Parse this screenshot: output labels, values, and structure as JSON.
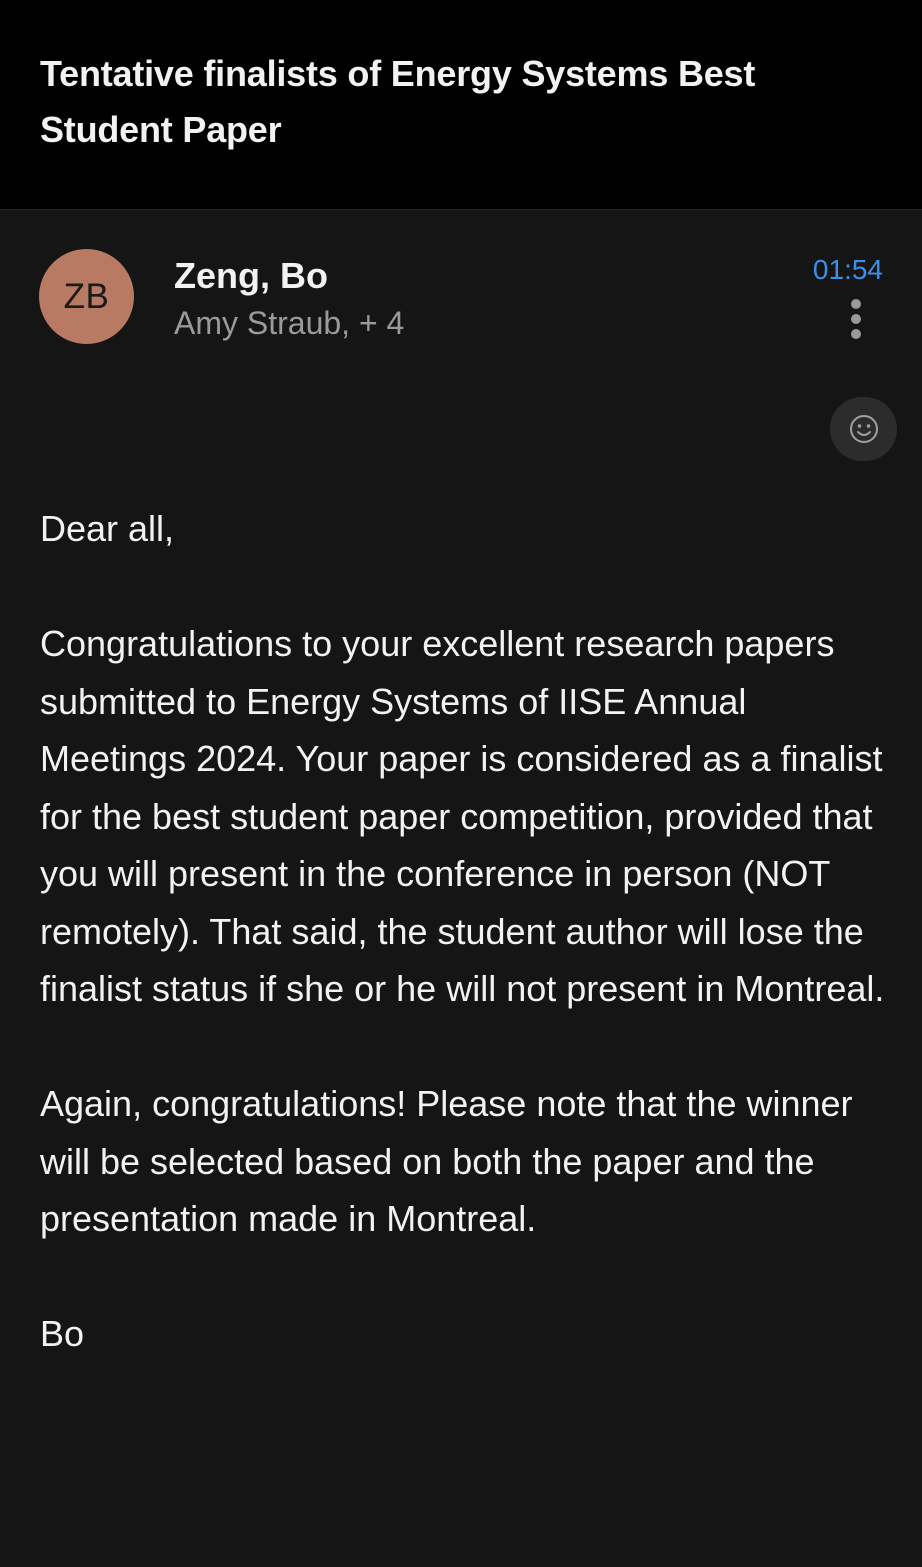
{
  "email": {
    "subject": "Tentative finalists of Energy Systems Best Student Paper",
    "sender": {
      "initials": "ZB",
      "name": "Zeng, Bo",
      "avatar_color": "#b97a63"
    },
    "recipients": "Amy Straub, + 4",
    "time": "01:54",
    "body": {
      "greeting": "Dear all,",
      "paragraph1": "Congratulations to your excellent research papers submitted to Energy Systems of IISE Annual Meetings 2024.  Your paper is considered as a finalist for the best student paper competition, provided that you will present in the conference in person (NOT remotely).  That said, the student author will lose the finalist status if she or he will not present in Montreal.",
      "paragraph2": "Again, congratulations! Please note that the winner will be selected based on both the paper and the presentation made in Montreal.",
      "signature": "Bo"
    }
  },
  "icons": {
    "more": "more-vertical-icon",
    "react": "smiley-icon"
  },
  "colors": {
    "background": "#151515",
    "header_background": "#000000",
    "time_accent": "#3d8fe8"
  }
}
